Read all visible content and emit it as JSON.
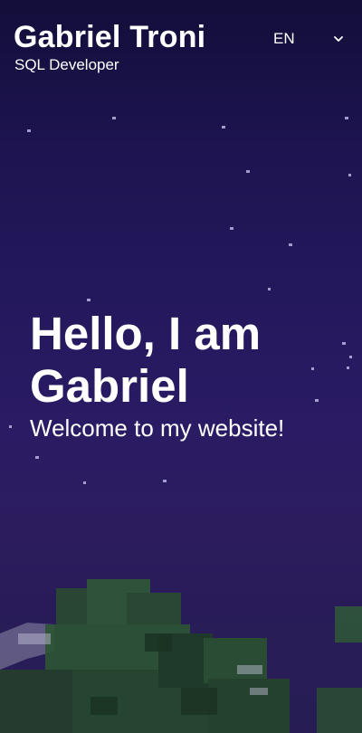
{
  "header": {
    "name": "Gabriel Troni",
    "role": "SQL Developer",
    "language": {
      "selected": "EN",
      "icon": "chevron-down-icon"
    }
  },
  "hero": {
    "title": "Hello, I am Gabriel",
    "subtitle": "Welcome to my website!"
  },
  "colors": {
    "sky_top": "#130e3a",
    "sky_mid": "#24185c",
    "sky_bottom": "#2c1c5e",
    "text": "#ffffff",
    "hill_green": "#2f5a37",
    "hill_dark": "#1e3a28"
  }
}
